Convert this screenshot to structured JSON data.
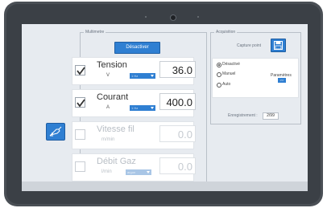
{
  "multimetre": {
    "legend": "Multimetre",
    "deactivate_label": "Désactiver",
    "rows": [
      {
        "label": "Tension",
        "unit": "V",
        "select": "1 Hz",
        "value": "36.0",
        "checked": true
      },
      {
        "label": "Courant",
        "unit": "A",
        "select": "1 Hz",
        "value": "400.0",
        "checked": true
      },
      {
        "label": "Vitesse fil",
        "unit": "m/min",
        "value": "0.0",
        "checked": false
      },
      {
        "label": "Débit Gaz",
        "unit": "l/min",
        "select": "argon",
        "value": "0.0",
        "checked": false
      }
    ]
  },
  "acquisition": {
    "legend": "Acquisition",
    "capture_label": "Capture point",
    "options": [
      {
        "label": "Désactivé",
        "selected": true
      },
      {
        "label": "Manuel",
        "selected": false
      },
      {
        "label": "Auto",
        "selected": false
      }
    ],
    "params_label": "Paramètres",
    "params_button": ">>",
    "record_label": "Enregistrement :",
    "record_value": "2/99"
  },
  "colors": {
    "accent": "#2f7fd2",
    "background": "#e7ebf0"
  },
  "icons": {
    "sidebar": "welding-torch-icon",
    "capture": "save-disk-icon",
    "check": "check-icon"
  }
}
